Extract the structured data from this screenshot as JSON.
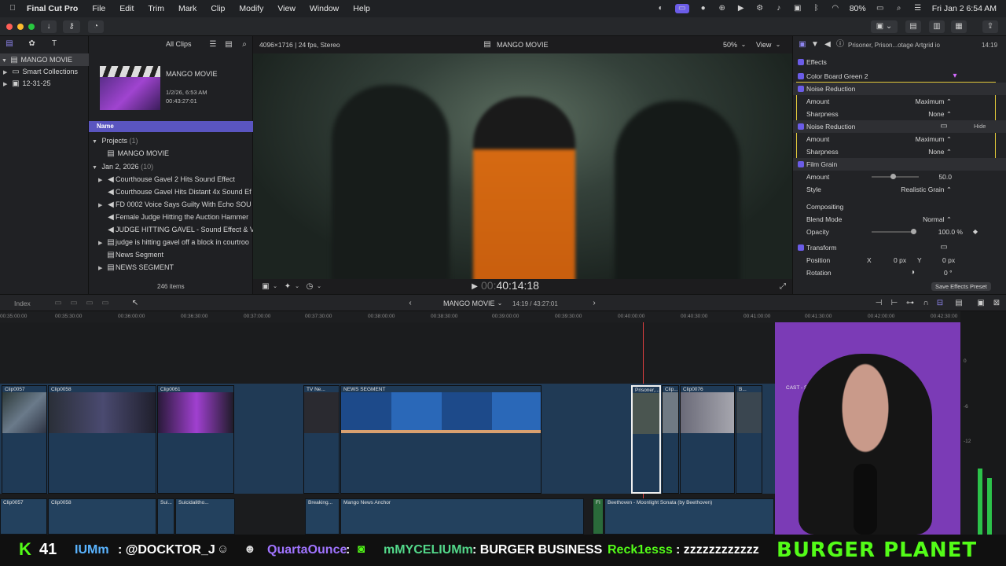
{
  "menubar": {
    "app": "Final Cut Pro",
    "items": [
      "File",
      "Edit",
      "Trim",
      "Mark",
      "Clip",
      "Modify",
      "View",
      "Window",
      "Help"
    ],
    "battery": "80%",
    "datetime": "Fri Jan 2  6:54 AM"
  },
  "library": {
    "name": "MANGO MOVIE",
    "items": [
      "Smart Collections",
      "12-31-25"
    ]
  },
  "browser": {
    "filter": "All Clips",
    "project_name": "MANGO MOVIE",
    "project_date": "1/2/26, 6:53 AM",
    "project_duration": "00:43:27:01",
    "column_name": "Name",
    "projects_label": "Projects",
    "projects_count": "(1)",
    "project_item": "MANGO MOVIE",
    "date_group": "Jan 2, 2026",
    "date_count": "(10)",
    "clips": [
      "Courthouse Gavel 2 Hits Sound Effect",
      "Courthouse Gavel Hits Distant 4x Sound Ef",
      "FD 0002  Voice Says Guilty With Echo SOU",
      "Female Judge Hitting the Auction Hammer",
      "JUDGE HITTING GAVEL - Sound Effect & V",
      "judge is hitting gavel off a block in courtroo",
      "News Segment",
      "NEWS SEGMENT"
    ],
    "item_count": "246 items"
  },
  "viewer": {
    "format": "4096×1716 | 24 fps, Stereo",
    "title": "MANGO MOVIE",
    "zoom": "50%",
    "view": "View",
    "timecode_dim": "00:",
    "timecode": "40:14:18"
  },
  "inspector": {
    "clip_title": "Prisoner, Prison...otage  Artgrid io",
    "duration": "14:19",
    "effects_label": "Effects",
    "rows": [
      {
        "label": "Color Board Green 2",
        "value": "",
        "check": true
      },
      {
        "label": "Noise Reduction",
        "value": "",
        "check": true
      },
      {
        "label": "Amount",
        "value": "Maximum ⌃",
        "check": false
      },
      {
        "label": "Sharpness",
        "value": "None ⌃",
        "check": false
      },
      {
        "label": "Noise Reduction",
        "value": "",
        "check": true
      },
      {
        "label": "Amount",
        "value": "Maximum ⌃",
        "check": false
      },
      {
        "label": "Sharpness",
        "value": "None ⌃",
        "check": false
      },
      {
        "label": "Film Grain",
        "value": "",
        "check": true
      },
      {
        "label": "Amount",
        "value": "50.0",
        "check": false
      },
      {
        "label": "Style",
        "value": "Realistic Grain ⌃",
        "check": false
      }
    ],
    "hide_label": "Hide",
    "compositing_label": "Compositing",
    "blend_mode_label": "Blend Mode",
    "blend_mode_value": "Normal ⌃",
    "opacity_label": "Opacity",
    "opacity_value": "100.0 %",
    "transform_label": "Transform",
    "position_label": "Position",
    "pos_x_label": "X",
    "pos_x": "0 px",
    "pos_y_label": "Y",
    "pos_y": "0 px",
    "rotation_label": "Rotation",
    "rotation_value": "0 °",
    "save_preset": "Save Effects Preset"
  },
  "timeline": {
    "index_label": "Index",
    "project": "MANGO MOVIE",
    "position": "14:19 / 43:27:01",
    "ruler": [
      "00:35:00:00",
      "00:35:30:00",
      "00:36:00:00",
      "00:36:30:00",
      "00:37:00:00",
      "00:37:30:00",
      "00:38:00:00",
      "00:38:30:00",
      "00:39:00:00",
      "00:39:30:00",
      "00:40:00:00",
      "00:40:30:00",
      "00:41:00:00",
      "00:41:30:00",
      "00:42:00:00",
      "00:42:30:00"
    ],
    "video_clips": [
      "Clip0057",
      "Clip0058",
      "Clip0061",
      "TV Ne...",
      "NEWS SEGMENT",
      "Prisoner,...",
      "Clip...",
      "Clip0076",
      "B...",
      "CAST - Scrolling"
    ],
    "audio_clips": [
      "Clip0057",
      "Clip0058",
      "Sui...",
      "Suicidalitho...",
      "Breaking...",
      "Mango News Anchor",
      "FI",
      "Beethoven - Moonlight Sonata (by Beethoven)"
    ],
    "meter_labels": [
      "0",
      "-6",
      "-12"
    ]
  },
  "chat": {
    "count": "41",
    "messages": [
      {
        "user": "IUMm",
        "text": ": @DOCKTOR_J"
      },
      {
        "user": "QuartaOunce",
        "text": ":"
      },
      {
        "user": "mMYCELIUMm",
        "text": ": BURGER BUSINESS"
      },
      {
        "user": "Reck1esss",
        "text": ": zzzzzzzzzzzz"
      }
    ],
    "banner": "BURGER PLANET"
  }
}
